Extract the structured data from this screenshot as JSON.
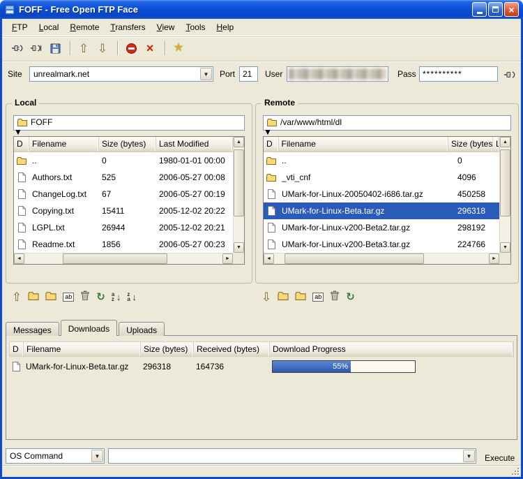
{
  "window": {
    "title": "FOFF - Free Open FTP Face"
  },
  "menu": {
    "items": [
      {
        "label": "FTP"
      },
      {
        "label": "Local"
      },
      {
        "label": "Remote"
      },
      {
        "label": "Transfers"
      },
      {
        "label": "View"
      },
      {
        "label": "Tools"
      },
      {
        "label": "Help"
      }
    ]
  },
  "connection": {
    "site_label": "Site",
    "site_value": "unrealmark.net",
    "port_label": "Port",
    "port_value": "21",
    "user_label": "User",
    "user_value": "",
    "pass_label": "Pass",
    "pass_value": "**********"
  },
  "local": {
    "title": "Local",
    "path_value": "FOFF",
    "columns": [
      "D",
      "Filename",
      "Size (bytes)",
      "Last Modified"
    ],
    "rows": [
      {
        "filename": "..",
        "size": "0",
        "modified": "1980-01-01 00:00"
      },
      {
        "filename": "Authors.txt",
        "size": "525",
        "modified": "2006-05-27 00:08"
      },
      {
        "filename": "ChangeLog.txt",
        "size": "67",
        "modified": "2006-05-27 00:19"
      },
      {
        "filename": "Copying.txt",
        "size": "15411",
        "modified": "2005-12-02 20:22"
      },
      {
        "filename": "LGPL.txt",
        "size": "26944",
        "modified": "2005-12-02 20:21"
      },
      {
        "filename": "Readme.txt",
        "size": "1856",
        "modified": "2006-05-27 00:23"
      }
    ]
  },
  "remote": {
    "title": "Remote",
    "path_value": "/var/www/html/dl",
    "columns": [
      "D",
      "Filename",
      "Size (bytes)",
      "L"
    ],
    "rows": [
      {
        "filename": "..",
        "size": "0"
      },
      {
        "filename": "_vti_cnf",
        "size": "4096"
      },
      {
        "filename": "UMark-for-Linux-20050402-i686.tar.gz",
        "size": "450258"
      },
      {
        "filename": "UMark-for-Linux-Beta.tar.gz",
        "size": "296318"
      },
      {
        "filename": "UMark-for-Linux-v200-Beta2.tar.gz",
        "size": "298192"
      },
      {
        "filename": "UMark-for-Linux-v200-Beta3.tar.gz",
        "size": "224766"
      }
    ]
  },
  "tabs": {
    "items": [
      {
        "label": "Messages"
      },
      {
        "label": "Downloads"
      },
      {
        "label": "Uploads"
      }
    ],
    "active": "Downloads"
  },
  "downloads": {
    "columns": [
      "D",
      "Filename",
      "Size (bytes)",
      "Received (bytes)",
      "Download Progress"
    ],
    "rows": [
      {
        "filename": "UMark-for-Linux-Beta.tar.gz",
        "size": "296318",
        "received": "164736",
        "progress_label": "55%",
        "progress_width": "55%"
      }
    ]
  },
  "command": {
    "selector_value": "OS Command",
    "input_value": "",
    "execute_label": "Execute"
  },
  "icons": {
    "up_arrow": "⇧",
    "down_arrow": "⇩",
    "abort_x": "×",
    "favorite_star": "★",
    "refresh": "↻",
    "rename": "ab",
    "sort_az": "az",
    "sort_za": "za",
    "sort_arrow": "↓",
    "combo_arrow": "▼",
    "scroll_up": "▲",
    "scroll_down": "▼",
    "scroll_left": "◄",
    "scroll_right": "►",
    "close": "×"
  },
  "colors": {
    "titlebar_blue": "#0B50D8",
    "window_bg": "#ECE9D8",
    "selection_blue": "#2B5BB8",
    "progress_blue": "#2E58AC"
  }
}
